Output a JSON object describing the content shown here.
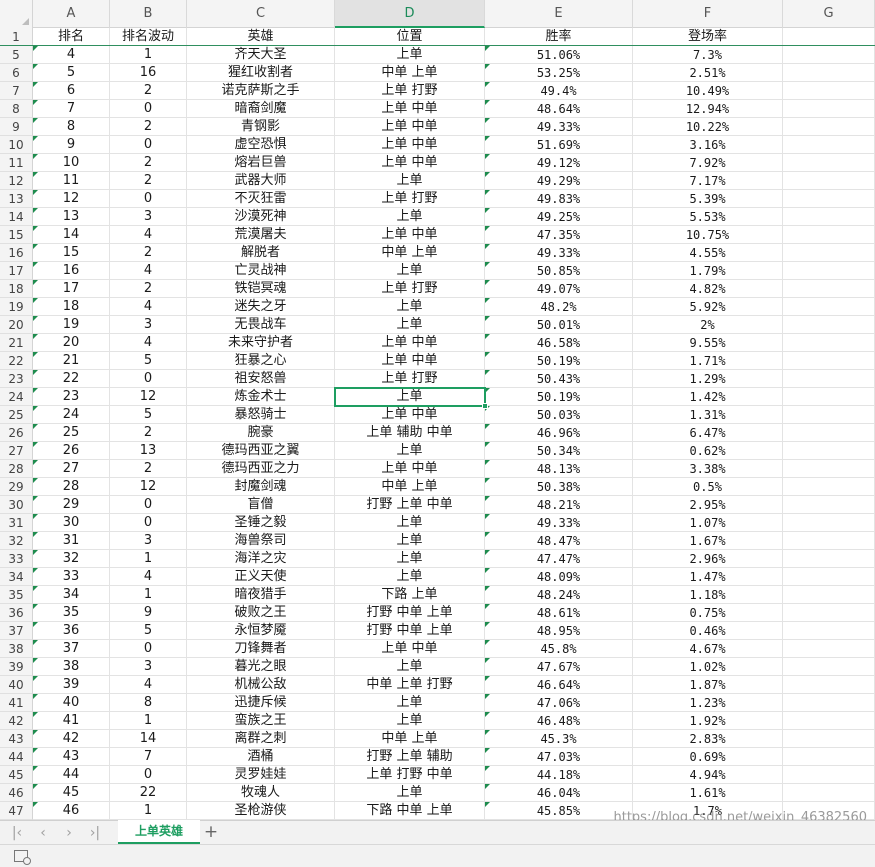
{
  "columns": [
    "A",
    "B",
    "C",
    "D",
    "E",
    "F",
    "G"
  ],
  "active_column": "D",
  "header_row": {
    "row_num": "1",
    "cells": [
      "排名",
      "排名波动",
      "英雄",
      "位置",
      "胜率",
      "登场率",
      ""
    ]
  },
  "rows": [
    {
      "n": "5",
      "c": [
        "4",
        "1",
        "齐天大圣",
        "上单",
        "51.06%",
        "7.3%"
      ]
    },
    {
      "n": "6",
      "c": [
        "5",
        "16",
        "猩红收割者",
        "中单 上单",
        "53.25%",
        "2.51%"
      ]
    },
    {
      "n": "7",
      "c": [
        "6",
        "2",
        "诺克萨斯之手",
        "上单 打野",
        "49.4%",
        "10.49%"
      ]
    },
    {
      "n": "8",
      "c": [
        "7",
        "0",
        "暗裔剑魔",
        "上单 中单",
        "48.64%",
        "12.94%"
      ]
    },
    {
      "n": "9",
      "c": [
        "8",
        "2",
        "青钢影",
        "上单 中单",
        "49.33%",
        "10.22%"
      ]
    },
    {
      "n": "10",
      "c": [
        "9",
        "0",
        "虚空恐惧",
        "上单 中单",
        "51.69%",
        "3.16%"
      ]
    },
    {
      "n": "11",
      "c": [
        "10",
        "2",
        "熔岩巨兽",
        "上单 中单",
        "49.12%",
        "7.92%"
      ]
    },
    {
      "n": "12",
      "c": [
        "11",
        "2",
        "武器大师",
        "上单",
        "49.29%",
        "7.17%"
      ]
    },
    {
      "n": "13",
      "c": [
        "12",
        "0",
        "不灭狂雷",
        "上单 打野",
        "49.83%",
        "5.39%"
      ]
    },
    {
      "n": "14",
      "c": [
        "13",
        "3",
        "沙漠死神",
        "上单",
        "49.25%",
        "5.53%"
      ]
    },
    {
      "n": "15",
      "c": [
        "14",
        "4",
        "荒漠屠夫",
        "上单 中单",
        "47.35%",
        "10.75%"
      ]
    },
    {
      "n": "16",
      "c": [
        "15",
        "2",
        "解脱者",
        "中单 上单",
        "49.33%",
        "4.55%"
      ]
    },
    {
      "n": "17",
      "c": [
        "16",
        "4",
        "亡灵战神",
        "上单",
        "50.85%",
        "1.79%"
      ]
    },
    {
      "n": "18",
      "c": [
        "17",
        "2",
        "铁铠冥魂",
        "上单 打野",
        "49.07%",
        "4.82%"
      ]
    },
    {
      "n": "19",
      "c": [
        "18",
        "4",
        "迷失之牙",
        "上单",
        "48.2%",
        "5.92%"
      ]
    },
    {
      "n": "20",
      "c": [
        "19",
        "3",
        "无畏战车",
        "上单",
        "50.01%",
        "2%"
      ]
    },
    {
      "n": "21",
      "c": [
        "20",
        "4",
        "未来守护者",
        "上单 中单",
        "46.58%",
        "9.55%"
      ]
    },
    {
      "n": "22",
      "c": [
        "21",
        "5",
        "狂暴之心",
        "上单 中单",
        "50.19%",
        "1.71%"
      ]
    },
    {
      "n": "23",
      "c": [
        "22",
        "0",
        "祖安怒兽",
        "上单 打野",
        "50.43%",
        "1.29%"
      ]
    },
    {
      "n": "24",
      "c": [
        "23",
        "12",
        "炼金术士",
        "上单",
        "50.19%",
        "1.42%"
      ]
    },
    {
      "n": "25",
      "c": [
        "24",
        "5",
        "暴怒骑士",
        "上单 中单",
        "50.03%",
        "1.31%"
      ]
    },
    {
      "n": "26",
      "c": [
        "25",
        "2",
        "腕豪",
        "上单 辅助 中单",
        "46.96%",
        "6.47%"
      ]
    },
    {
      "n": "27",
      "c": [
        "26",
        "13",
        "德玛西亚之翼",
        "上单",
        "50.34%",
        "0.62%"
      ]
    },
    {
      "n": "28",
      "c": [
        "27",
        "2",
        "德玛西亚之力",
        "上单 中单",
        "48.13%",
        "3.38%"
      ]
    },
    {
      "n": "29",
      "c": [
        "28",
        "12",
        "封魔剑魂",
        "中单 上单",
        "50.38%",
        "0.5%"
      ]
    },
    {
      "n": "30",
      "c": [
        "29",
        "0",
        "盲僧",
        "打野 上单 中单",
        "48.21%",
        "2.95%"
      ]
    },
    {
      "n": "31",
      "c": [
        "30",
        "0",
        "圣锤之毅",
        "上单",
        "49.33%",
        "1.07%"
      ]
    },
    {
      "n": "32",
      "c": [
        "31",
        "3",
        "海兽祭司",
        "上单",
        "48.47%",
        "1.67%"
      ]
    },
    {
      "n": "33",
      "c": [
        "32",
        "1",
        "海洋之灾",
        "上单",
        "47.47%",
        "2.96%"
      ]
    },
    {
      "n": "34",
      "c": [
        "33",
        "4",
        "正义天使",
        "上单",
        "48.09%",
        "1.47%"
      ]
    },
    {
      "n": "35",
      "c": [
        "34",
        "1",
        "暗夜猎手",
        "下路 上单",
        "48.24%",
        "1.18%"
      ]
    },
    {
      "n": "36",
      "c": [
        "35",
        "9",
        "破败之王",
        "打野 中单 上单",
        "48.61%",
        "0.75%"
      ]
    },
    {
      "n": "37",
      "c": [
        "36",
        "5",
        "永恒梦魇",
        "打野 中单 上单",
        "48.95%",
        "0.46%"
      ]
    },
    {
      "n": "38",
      "c": [
        "37",
        "0",
        "刀锋舞者",
        "上单 中单",
        "45.8%",
        "4.67%"
      ]
    },
    {
      "n": "39",
      "c": [
        "38",
        "3",
        "暮光之眼",
        "上单",
        "47.67%",
        "1.02%"
      ]
    },
    {
      "n": "40",
      "c": [
        "39",
        "4",
        "机械公敌",
        "中单 上单 打野",
        "46.64%",
        "1.87%"
      ]
    },
    {
      "n": "41",
      "c": [
        "40",
        "8",
        "迅捷斥候",
        "上单",
        "47.06%",
        "1.23%"
      ]
    },
    {
      "n": "42",
      "c": [
        "41",
        "1",
        "蛮族之王",
        "上单",
        "46.48%",
        "1.92%"
      ]
    },
    {
      "n": "43",
      "c": [
        "42",
        "14",
        "离群之刺",
        "中单 上单",
        "45.3%",
        "2.83%"
      ]
    },
    {
      "n": "44",
      "c": [
        "43",
        "7",
        "酒桶",
        "打野 上单 辅助",
        "47.03%",
        "0.69%"
      ]
    },
    {
      "n": "45",
      "c": [
        "44",
        "0",
        "灵罗娃娃",
        "上单 打野 中单",
        "44.18%",
        "4.94%"
      ]
    },
    {
      "n": "46",
      "c": [
        "45",
        "22",
        "牧魂人",
        "上单",
        "46.04%",
        "1.61%"
      ]
    },
    {
      "n": "47",
      "c": [
        "46",
        "1",
        "圣枪游侠",
        "下路 中单 上单",
        "45.85%",
        "1.7%"
      ]
    }
  ],
  "selected_cell": {
    "column": "D",
    "row": "24"
  },
  "sheet_tabs": [
    "上单英雄"
  ],
  "active_sheet": "上单英雄",
  "watermark": "https://blog.csdn.net/weixin_46382560",
  "icons": {
    "first_sheet": "first-sheet-icon",
    "prev_sheet": "prev-sheet-icon",
    "next_sheet": "next-sheet-icon",
    "last_sheet": "last-sheet-icon",
    "add_sheet": "plus-icon",
    "macro": "macro-record-icon"
  },
  "colors": {
    "accent": "#1e9e61",
    "freeze_line": "#2f8f5f",
    "error_marker": "#1e8c4e"
  }
}
